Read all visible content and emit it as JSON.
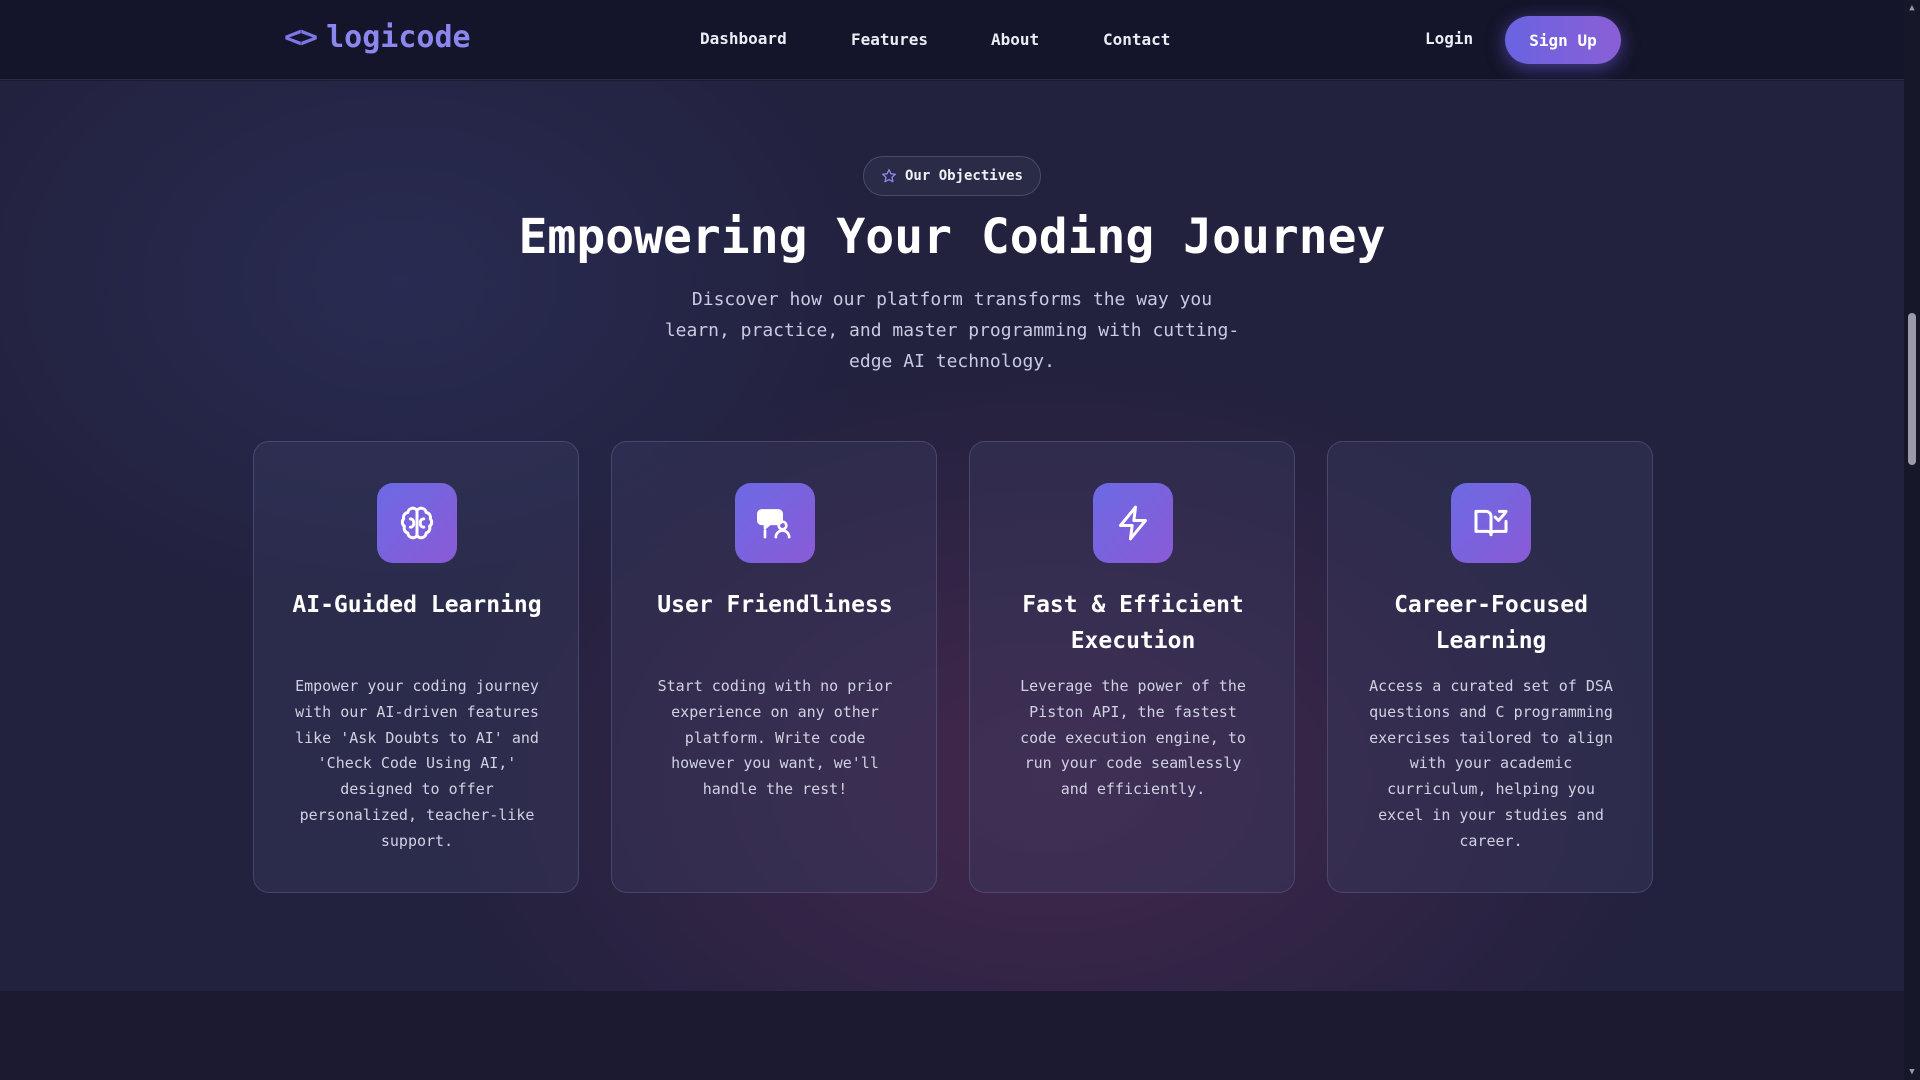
{
  "nav": {
    "logo_symbol": "<>",
    "logo_text": "logicode",
    "links": [
      "Dashboard",
      "Features",
      "About",
      "Contact"
    ],
    "login": "Login",
    "signup": "Sign Up"
  },
  "hero": {
    "badge": "Our Objectives",
    "title": "Empowering Your Coding Journey",
    "subtitle": "Discover how our platform transforms the way you learn, practice, and master programming with cutting-edge AI technology."
  },
  "cards": [
    {
      "icon": "brain-icon",
      "title": "AI-Guided Learning",
      "desc": "Empower your coding journey with our AI-driven features like 'Ask Doubts to AI' and 'Check Code Using AI,' designed to offer personalized, teacher-like support."
    },
    {
      "icon": "user-chat-icon",
      "title": "User Friendliness",
      "desc": "Start coding with no prior experience on any other platform. Write code however you want, we'll handle the rest!"
    },
    {
      "icon": "lightning-icon",
      "title": "Fast & Efficient Execution",
      "desc": "Leverage the power of the Piston API, the fastest code execution engine, to run your code seamlessly and efficiently."
    },
    {
      "icon": "book-check-icon",
      "title": "Career-Focused Learning",
      "desc": "Access a curated set of DSA questions and C programming exercises tailored to align with your academic curriculum, helping you excel in your studies and career."
    }
  ],
  "colors": {
    "accent": "#6c6ae4",
    "accent2": "#8a5ad6",
    "background": "#22213e",
    "navbar": "#14152a"
  }
}
